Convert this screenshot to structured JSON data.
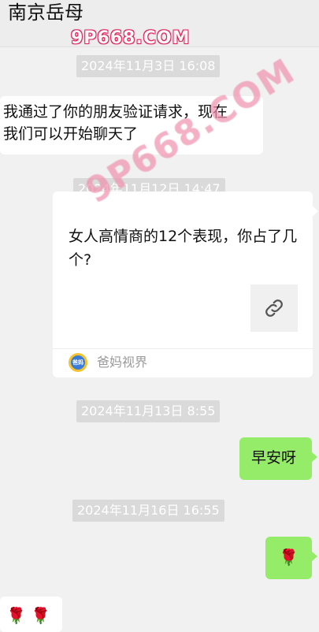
{
  "header": {
    "title": "南京岳母",
    "watermark": "9P668.COM"
  },
  "watermark_diag": "9P668.COM",
  "messages": {
    "ts1": "2024年11月3日 16:08",
    "msg1_line1": "我通过了你的朋友验证请求，现在",
    "msg1_line2": "我们可以开始聊天了",
    "ts2": "2024年11月12日 14:47",
    "link_title": "女人高情商的12个表现，你占了几个?",
    "link_source": "爸妈视界",
    "source_logo_text": "爸妈",
    "ts3": "2024年11月13日 8:55",
    "msg2": "早安呀",
    "ts4": "2024年11月16日 16:55",
    "msg3": "🌹",
    "msg4": "🌹 🌹"
  },
  "colors": {
    "sent_bubble": "#95ec69",
    "received_bubble": "#ffffff",
    "background": "#f1f1f1",
    "timestamp_bg": "#dadada"
  }
}
